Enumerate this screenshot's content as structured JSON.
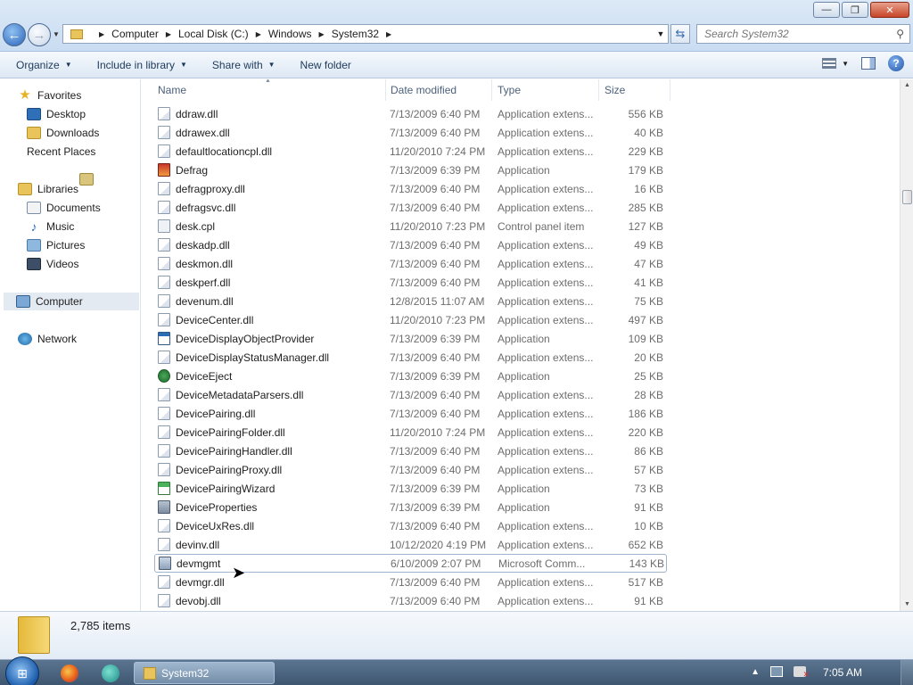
{
  "window": {
    "controls": {
      "minimize": "—",
      "maximize": "❐",
      "close": "✕"
    }
  },
  "address": {
    "breadcrumbs": [
      "Computer",
      "Local Disk (C:)",
      "Windows",
      "System32"
    ],
    "search_placeholder": "Search System32"
  },
  "toolbar": {
    "organize": "Organize",
    "include_in_library": "Include in library",
    "share_with": "Share with",
    "new_folder": "New folder"
  },
  "nav": {
    "favorites": "Favorites",
    "desktop": "Desktop",
    "downloads": "Downloads",
    "recent_places": "Recent Places",
    "libraries": "Libraries",
    "documents": "Documents",
    "music": "Music",
    "pictures": "Pictures",
    "videos": "Videos",
    "computer": "Computer",
    "network": "Network"
  },
  "columns": {
    "name": "Name",
    "date": "Date modified",
    "type": "Type",
    "size": "Size"
  },
  "files": [
    {
      "name": "ddraw.dll",
      "date": "7/13/2009 6:40 PM",
      "type": "Application extens...",
      "size": "556 KB",
      "icon": "dll-icon"
    },
    {
      "name": "ddrawex.dll",
      "date": "7/13/2009 6:40 PM",
      "type": "Application extens...",
      "size": "40 KB",
      "icon": "dll-icon"
    },
    {
      "name": "defaultlocationcpl.dll",
      "date": "11/20/2010 7:24 PM",
      "type": "Application extens...",
      "size": "229 KB",
      "icon": "dll-icon"
    },
    {
      "name": "Defrag",
      "date": "7/13/2009 6:39 PM",
      "type": "Application",
      "size": "179 KB",
      "icon": "defrag-icon"
    },
    {
      "name": "defragproxy.dll",
      "date": "7/13/2009 6:40 PM",
      "type": "Application extens...",
      "size": "16 KB",
      "icon": "dll-icon"
    },
    {
      "name": "defragsvc.dll",
      "date": "7/13/2009 6:40 PM",
      "type": "Application extens...",
      "size": "285 KB",
      "icon": "dll-icon"
    },
    {
      "name": "desk.cpl",
      "date": "11/20/2010 7:23 PM",
      "type": "Control panel item",
      "size": "127 KB",
      "icon": "cpl-icon"
    },
    {
      "name": "deskadp.dll",
      "date": "7/13/2009 6:40 PM",
      "type": "Application extens...",
      "size": "49 KB",
      "icon": "dll-icon"
    },
    {
      "name": "deskmon.dll",
      "date": "7/13/2009 6:40 PM",
      "type": "Application extens...",
      "size": "47 KB",
      "icon": "dll-icon"
    },
    {
      "name": "deskperf.dll",
      "date": "7/13/2009 6:40 PM",
      "type": "Application extens...",
      "size": "41 KB",
      "icon": "dll-icon"
    },
    {
      "name": "devenum.dll",
      "date": "12/8/2015 11:07 AM",
      "type": "Application extens...",
      "size": "75 KB",
      "icon": "dll-icon"
    },
    {
      "name": "DeviceCenter.dll",
      "date": "11/20/2010 7:23 PM",
      "type": "Application extens...",
      "size": "497 KB",
      "icon": "dll-icon"
    },
    {
      "name": "DeviceDisplayObjectProvider",
      "date": "7/13/2009 6:39 PM",
      "type": "Application",
      "size": "109 KB",
      "icon": "app-window-icon"
    },
    {
      "name": "DeviceDisplayStatusManager.dll",
      "date": "7/13/2009 6:40 PM",
      "type": "Application extens...",
      "size": "20 KB",
      "icon": "dll-icon"
    },
    {
      "name": "DeviceEject",
      "date": "7/13/2009 6:39 PM",
      "type": "Application",
      "size": "25 KB",
      "icon": "eject-icon"
    },
    {
      "name": "DeviceMetadataParsers.dll",
      "date": "7/13/2009 6:40 PM",
      "type": "Application extens...",
      "size": "28 KB",
      "icon": "dll-icon"
    },
    {
      "name": "DevicePairing.dll",
      "date": "7/13/2009 6:40 PM",
      "type": "Application extens...",
      "size": "186 KB",
      "icon": "dll-icon"
    },
    {
      "name": "DevicePairingFolder.dll",
      "date": "11/20/2010 7:24 PM",
      "type": "Application extens...",
      "size": "220 KB",
      "icon": "dll-icon"
    },
    {
      "name": "DevicePairingHandler.dll",
      "date": "7/13/2009 6:40 PM",
      "type": "Application extens...",
      "size": "86 KB",
      "icon": "dll-icon"
    },
    {
      "name": "DevicePairingProxy.dll",
      "date": "7/13/2009 6:40 PM",
      "type": "Application extens...",
      "size": "57 KB",
      "icon": "dll-icon"
    },
    {
      "name": "DevicePairingWizard",
      "date": "7/13/2009 6:39 PM",
      "type": "Application",
      "size": "73 KB",
      "icon": "wizard-icon"
    },
    {
      "name": "DeviceProperties",
      "date": "7/13/2009 6:39 PM",
      "type": "Application",
      "size": "91 KB",
      "icon": "properties-icon"
    },
    {
      "name": "DeviceUxRes.dll",
      "date": "7/13/2009 6:40 PM",
      "type": "Application extens...",
      "size": "10 KB",
      "icon": "dll-icon"
    },
    {
      "name": "devinv.dll",
      "date": "10/12/2020 4:19 PM",
      "type": "Application extens...",
      "size": "652 KB",
      "icon": "dll-icon"
    },
    {
      "name": "devmgmt",
      "date": "6/10/2009 2:07 PM",
      "type": "Microsoft Comm...",
      "size": "143 KB",
      "icon": "mmc-icon",
      "selected": true
    },
    {
      "name": "devmgr.dll",
      "date": "7/13/2009 6:40 PM",
      "type": "Application extens...",
      "size": "517 KB",
      "icon": "dll-icon"
    },
    {
      "name": "devobj.dll",
      "date": "7/13/2009 6:40 PM",
      "type": "Application extens...",
      "size": "91 KB",
      "icon": "dll-icon"
    }
  ],
  "status": {
    "item_count": "2,785 items"
  },
  "taskbar": {
    "task_label": "System32",
    "clock": "7:05 AM"
  }
}
